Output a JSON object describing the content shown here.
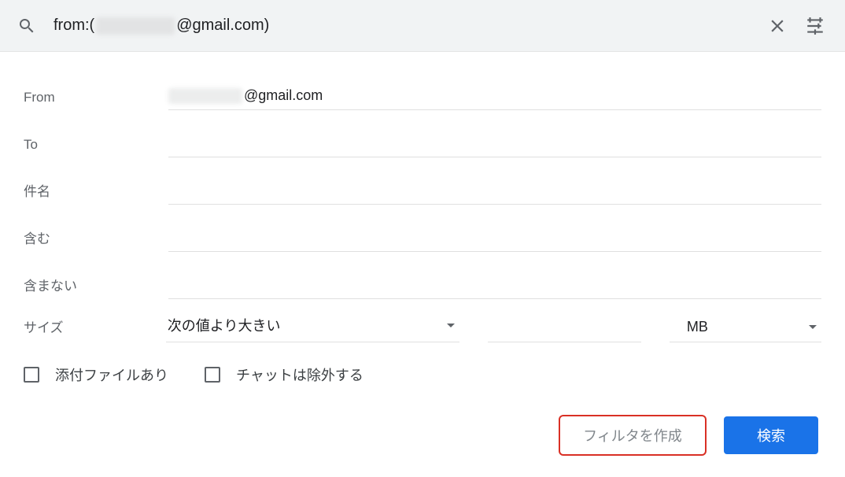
{
  "search": {
    "prefix": "from:(",
    "domain": "@gmail.com",
    "suffix": ")"
  },
  "labels": {
    "from": "From",
    "to": "To",
    "subject": "件名",
    "has_words": "含む",
    "doesnt_have": "含まない",
    "size": "サイズ"
  },
  "from_value_suffix": "@gmail.com",
  "size": {
    "compare": "次の値より大きい",
    "unit": "MB"
  },
  "checks": {
    "has_attachment": "添付ファイルあり",
    "exclude_chats": "チャットは除外する"
  },
  "buttons": {
    "create_filter": "フィルタを作成",
    "search": "検索"
  }
}
